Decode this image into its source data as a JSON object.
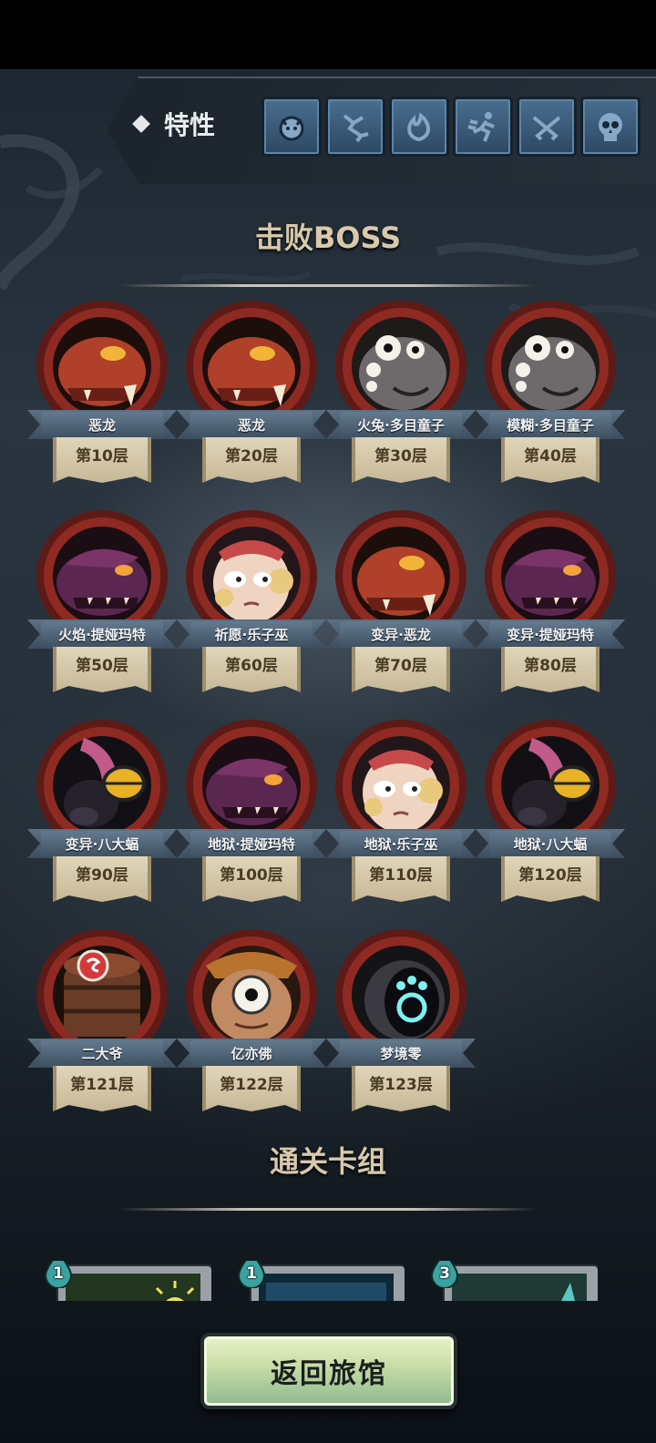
{
  "traits": {
    "label": "特性",
    "icons": [
      "beast-icon",
      "lightning-crack-icon",
      "flame-icon",
      "sprint-icon",
      "crossed-guns-icon",
      "skull-icon"
    ]
  },
  "bosses_section": {
    "title": "击败BOSS"
  },
  "bosses": [
    {
      "name": "恶龙",
      "floor": "第10层",
      "portrait": "red-dragon-icon"
    },
    {
      "name": "恶龙",
      "floor": "第20层",
      "portrait": "red-dragon-icon"
    },
    {
      "name": "火兔·多目童子",
      "floor": "第30层",
      "portrait": "multi-eye-child-icon"
    },
    {
      "name": "模糊·多目童子",
      "floor": "第40层",
      "portrait": "multi-eye-child-icon"
    },
    {
      "name": "火焰·提娅玛特",
      "floor": "第50层",
      "portrait": "purple-dragon-icon"
    },
    {
      "name": "祈愿·乐子巫",
      "floor": "第60层",
      "portrait": "jester-witch-icon"
    },
    {
      "name": "变异·恶龙",
      "floor": "第70层",
      "portrait": "red-dragon-icon"
    },
    {
      "name": "变异·提娅玛特",
      "floor": "第80层",
      "portrait": "purple-dragon-icon"
    },
    {
      "name": "变异·八大蝠",
      "floor": "第90层",
      "portrait": "bat-icon"
    },
    {
      "name": "地狱·提娅玛特",
      "floor": "第100层",
      "portrait": "purple-dragon-icon"
    },
    {
      "name": "地狱·乐子巫",
      "floor": "第110层",
      "portrait": "jester-witch-icon"
    },
    {
      "name": "地狱·八大蝠",
      "floor": "第120层",
      "portrait": "bat-icon"
    },
    {
      "name": "二大爷",
      "floor": "第121层",
      "portrait": "barrel-icon"
    },
    {
      "name": "亿亦佛",
      "floor": "第122层",
      "portrait": "cyclops-monk-icon"
    },
    {
      "name": "梦境零",
      "floor": "第123层",
      "portrait": "dream-zero-icon"
    }
  ],
  "deck_section": {
    "title": "通关卡组",
    "cards": [
      {
        "cost": "1",
        "art": "sun-card-icon"
      },
      {
        "cost": "1",
        "art": "blue-card-icon"
      },
      {
        "cost": "3",
        "art": "green-card-icon"
      }
    ]
  },
  "return_button": {
    "label": "返回旅馆"
  },
  "colors": {
    "medallion_red": "#8e2a22",
    "ribbon_blue": "#4f6478",
    "floor_parchment": "#d9ccad",
    "title_gold": "#d8c9ab",
    "button_green": "#c9dfa7",
    "trait_blue": "#3b5b7a"
  }
}
